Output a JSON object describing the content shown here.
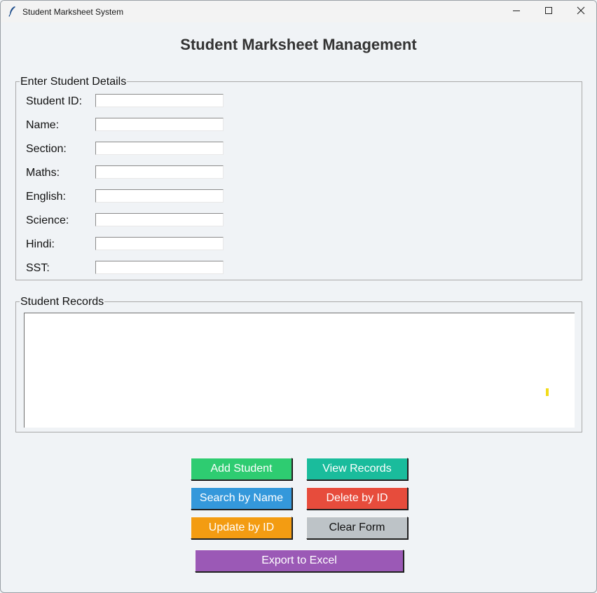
{
  "window": {
    "title": "Student Marksheet System",
    "icon": "feather-icon",
    "controls": [
      "minimize-icon",
      "maximize-icon",
      "close-icon"
    ]
  },
  "header": {
    "title": "Student Marksheet Management"
  },
  "details_group": {
    "label": "Enter Student Details",
    "fields": [
      {
        "label": "Student ID:",
        "value": ""
      },
      {
        "label": "Name:",
        "value": ""
      },
      {
        "label": "Section:",
        "value": ""
      },
      {
        "label": "Maths:",
        "value": ""
      },
      {
        "label": "English:",
        "value": ""
      },
      {
        "label": "Science:",
        "value": ""
      },
      {
        "label": "Hindi:",
        "value": ""
      },
      {
        "label": "SST:",
        "value": ""
      }
    ]
  },
  "records_group": {
    "label": "Student Records",
    "content": ""
  },
  "buttons": {
    "add": {
      "label": "Add Student",
      "color": "#2ecc71"
    },
    "view": {
      "label": "View Records",
      "color": "#1abc9c"
    },
    "search": {
      "label": "Search by Name",
      "color": "#3498db"
    },
    "delete": {
      "label": "Delete by ID",
      "color": "#e74c3c"
    },
    "update": {
      "label": "Update by ID",
      "color": "#f39c12"
    },
    "clear": {
      "label": "Clear Form",
      "color": "#bdc3c7"
    },
    "export": {
      "label": "Export to Excel",
      "color": "#9b59b6"
    }
  },
  "colors": {
    "background": "#f0f3f6",
    "title_text": "#333333",
    "clear_text": "#111111"
  }
}
